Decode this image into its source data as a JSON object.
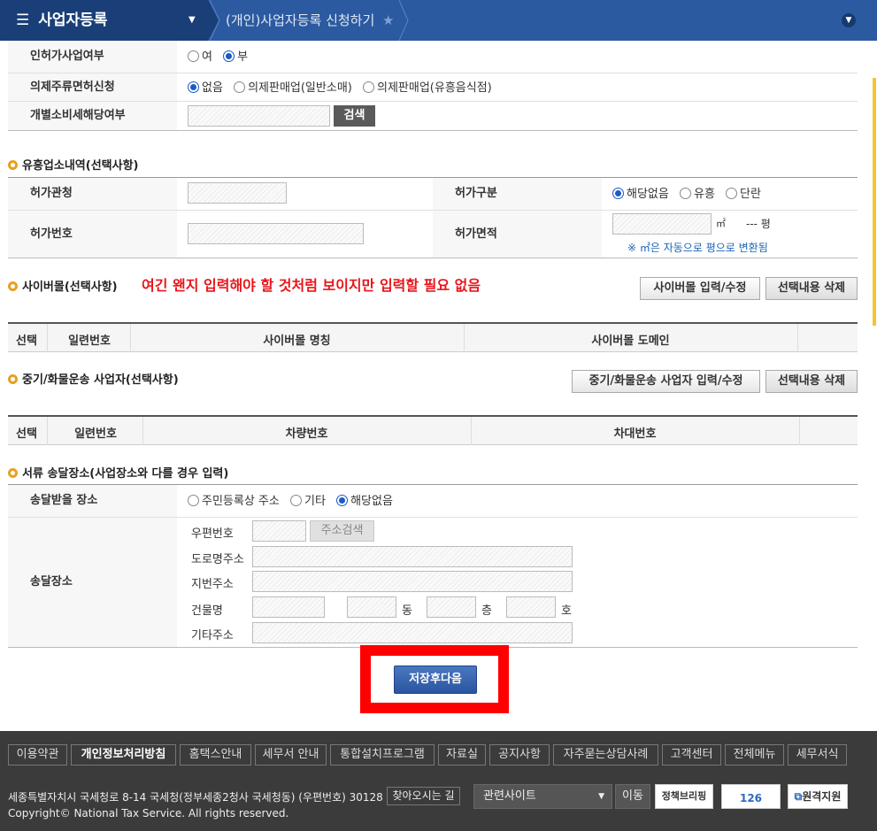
{
  "header": {
    "menu_icon": "☰",
    "menu_title": "사업자등록",
    "dropdown_icon": "▼",
    "breadcrumb": "(개인)사업자등록 신청하기",
    "star_icon": "★",
    "expand_icon": "⌄"
  },
  "license": {
    "label": "인허가사업여부",
    "opt1": "여",
    "opt2": "부"
  },
  "liquor": {
    "label": "의제주류면허신청",
    "opt1": "없음",
    "opt2": "의제판매업(일반소매)",
    "opt3": "의제판매업(유흥음식점)"
  },
  "excise": {
    "label": "개별소비세해당여부",
    "search_btn": "검색"
  },
  "entertainment": {
    "title": "유흥업소내역(선택사항)",
    "auth_label": "허가관청",
    "type_label": "허가구분",
    "type_opt1": "해당없음",
    "type_opt2": "유흥",
    "type_opt3": "단란",
    "num_label": "허가번호",
    "area_label": "허가면적",
    "area_unit": "㎡",
    "pyeong": "--- 평",
    "note": "※ ㎡은 자동으로 평으로 변환됨"
  },
  "cybermall": {
    "title": "사이버몰(선택사항)",
    "warning": "여긴 왠지 입력해야 할 것처럼 보이지만 입력할 필요 없음",
    "edit_btn": "사이버몰 입력/수정",
    "delete_btn": "선택내용 삭제",
    "cols": [
      "선택",
      "일련번호",
      "사이버몰 명칭",
      "사이버몰 도메인"
    ]
  },
  "heavy": {
    "title": "중기/화물운송 사업자(선택사항)",
    "edit_btn": "중기/화물운송 사업자 입력/수정",
    "delete_btn": "선택내용 삭제",
    "cols": [
      "선택",
      "일련번호",
      "차량번호",
      "차대번호"
    ]
  },
  "delivery": {
    "title": "서류 송달장소(사업장소와 다를 경우 입력)",
    "place_label": "송달받을 장소",
    "opt1": "주민등록상 주소",
    "opt2": "기타",
    "opt3": "해당없음",
    "addr_label": "송달장소",
    "zip": "우편번호",
    "zip_btn": "주소검색",
    "road": "도로명주소",
    "lot": "지번주소",
    "building": "건물명",
    "dong": "동",
    "floor": "층",
    "ho": "호",
    "etc": "기타주소"
  },
  "save_btn": "저장후다음",
  "footer": {
    "links": [
      "이용약관",
      "개인정보처리방침",
      "홈택스안내",
      "세무서 안내",
      "통합설치프로그램",
      "자료실",
      "공지사항",
      "자주묻는상담사례",
      "고객센터",
      "전체메뉴",
      "세무서식"
    ],
    "address": "세종특별자치시 국세청로 8-14 국세청(정부세종2청사 국세청동) (우편번호) 30128",
    "directions": "찾아오시는 길",
    "copyright": "Copyright© National Tax Service. All rights reserved.",
    "related": "관련사이트",
    "go_btn": "이동",
    "briefing": "정책브리핑",
    "num126": "126",
    "remote": "원격지원"
  }
}
